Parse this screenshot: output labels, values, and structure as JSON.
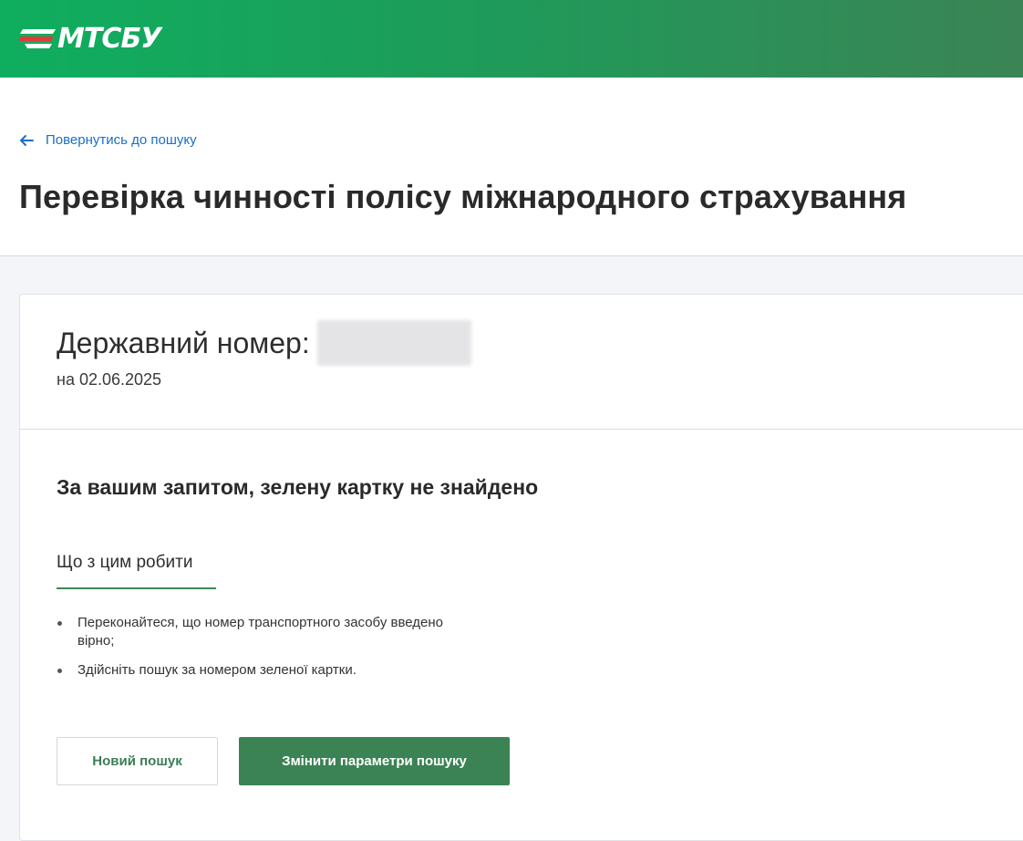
{
  "brand": {
    "logo_text": "МТСБУ",
    "colors": {
      "header_start": "#0fae5f",
      "header_end": "#3b8455",
      "accent": "#3b8354",
      "link": "#1a6fc7"
    }
  },
  "nav": {
    "back_link_label": "Повернутись до пошуку",
    "back_icon": "arrow-left-icon"
  },
  "page": {
    "title": "Перевірка чинності полісу міжнародного страхування"
  },
  "result_card": {
    "plate_label": "Державний номер:",
    "date_line": "на 02.06.2025",
    "result_title": "За вашим запитом, зелену картку не знайдено",
    "tab_label": "Що з цим робити",
    "tips": [
      "Переконайтеся, що номер транспортного засобу введено вірно;",
      "Здійсніть пошук за номером зеленої картки."
    ],
    "buttons": {
      "new_search": "Новий пошук",
      "change_params": "Змінити параметри пошуку"
    }
  }
}
